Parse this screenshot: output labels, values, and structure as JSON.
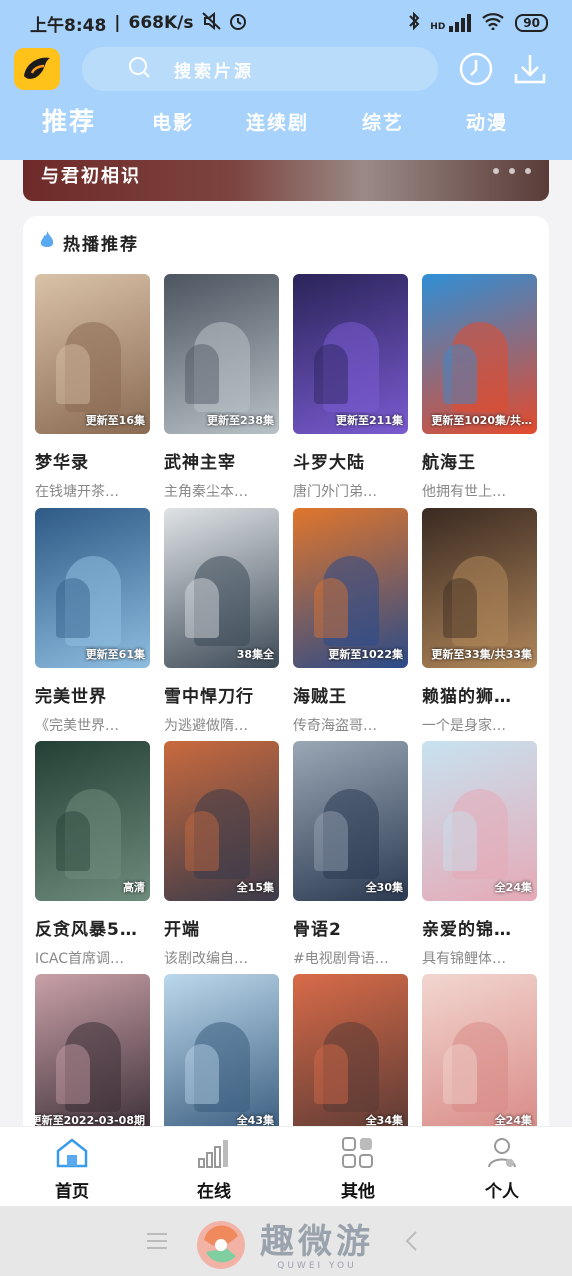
{
  "status_bar": {
    "time": "上午8:48",
    "speed": "668K/s",
    "network": "HD",
    "battery": "90"
  },
  "header": {
    "search_placeholder": "搜索片源",
    "tabs": [
      {
        "label": "推荐",
        "active": true
      },
      {
        "label": "电影",
        "active": false
      },
      {
        "label": "连续剧",
        "active": false
      },
      {
        "label": "综艺",
        "active": false
      },
      {
        "label": "动漫",
        "active": false
      }
    ]
  },
  "banner": {
    "title": "与君初相识"
  },
  "hot": {
    "section_title": "热播推荐",
    "items": [
      {
        "title": "梦华录",
        "desc": "在钱塘开茶…",
        "badge": "更新至16集",
        "color1": "#d9c2a8",
        "color2": "#8a6a52"
      },
      {
        "title": "武神主宰",
        "desc": "主角秦尘本…",
        "badge": "更新至238集",
        "color1": "#4c5560",
        "color2": "#b8c1c6"
      },
      {
        "title": "斗罗大陆",
        "desc": "唐门外门弟…",
        "badge": "更新至211集",
        "color1": "#2a2458",
        "color2": "#7a5bd1"
      },
      {
        "title": "航海王",
        "desc": "他拥有世上…",
        "badge": "更新至1020集/共…",
        "color1": "#2f8fd6",
        "color2": "#e44a2c"
      },
      {
        "title": "完美世界",
        "desc": "《完美世界…",
        "badge": "更新至61集",
        "color1": "#2e5a86",
        "color2": "#8fbde0"
      },
      {
        "title": "雪中悍刀行",
        "desc": "为逃避做隋…",
        "badge": "38集全",
        "color1": "#dfe3e6",
        "color2": "#3d4a57"
      },
      {
        "title": "海贼王",
        "desc": "传奇海盗哥…",
        "badge": "更新至1022集",
        "color1": "#e0762c",
        "color2": "#2a4b8a"
      },
      {
        "title": "赖猫的狮…",
        "desc": "一个是身家…",
        "badge": "更新至33集/共33集",
        "color1": "#3a2a22",
        "color2": "#b1875a"
      },
      {
        "title": "反贪风暴5…",
        "desc": "ICAC首席调…",
        "badge": "高清",
        "color1": "#234036",
        "color2": "#6e8c7c"
      },
      {
        "title": "开端",
        "desc": "该剧改编自…",
        "badge": "全15集",
        "color1": "#c96a3e",
        "color2": "#3b3b4a"
      },
      {
        "title": "骨语2",
        "desc": "#电视剧骨语…",
        "badge": "全30集",
        "color1": "#9aa7b5",
        "color2": "#2c3a52"
      },
      {
        "title": "亲爱的锦…",
        "desc": "具有锦鲤体…",
        "badge": "全24集",
        "color1": "#c7e2f0",
        "color2": "#e6a9b6"
      },
      {
        "title": "",
        "desc": "",
        "badge": "更新至2022-03-08期",
        "color1": "#c9a0a8",
        "color2": "#3c2f37"
      },
      {
        "title": "",
        "desc": "",
        "badge": "全43集",
        "color1": "#bcd8ec",
        "color2": "#3a5c7e"
      },
      {
        "title": "",
        "desc": "",
        "badge": "全34集",
        "color1": "#d86b49",
        "color2": "#5a3a34"
      },
      {
        "title": "",
        "desc": "",
        "badge": "全24集",
        "color1": "#f2d6d0",
        "color2": "#d98a86"
      }
    ]
  },
  "bottom_nav": [
    {
      "label": "首页",
      "active": true
    },
    {
      "label": "在线",
      "active": false
    },
    {
      "label": "其他",
      "active": false
    },
    {
      "label": "个人",
      "active": false
    }
  ],
  "watermark": {
    "main": "趣微游",
    "sub": "QUWEI YOU"
  },
  "colors": {
    "header_bg": "#a7d2fb",
    "logo_bg": "#ffc21a",
    "accent": "#3a9be8"
  }
}
